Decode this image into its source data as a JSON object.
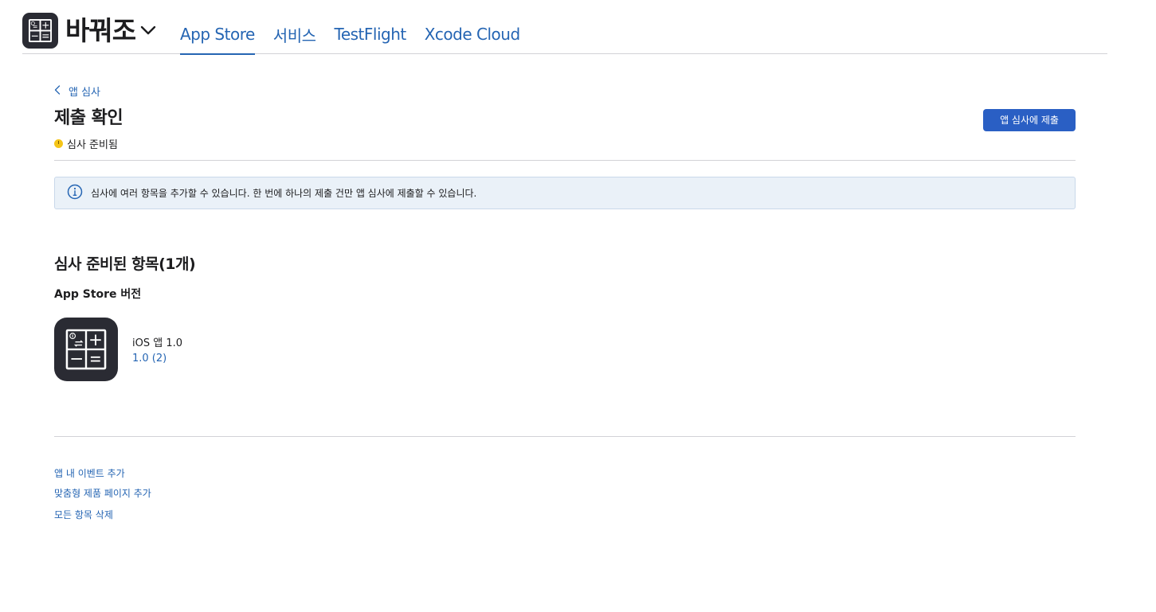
{
  "header": {
    "app_name": "바꿔조",
    "app_icon": "calculator-icon",
    "tabs": [
      {
        "label": "App Store",
        "active": true
      },
      {
        "label": "서비스",
        "active": false
      },
      {
        "label": "TestFlight",
        "active": false
      },
      {
        "label": "Xcode Cloud",
        "active": false
      }
    ]
  },
  "breadcrumb": {
    "label": "앱 심사"
  },
  "page": {
    "title": "제출 확인",
    "status": "심사 준비됨",
    "status_color": "#f5c518",
    "submit_button": "앱 심사에 제출"
  },
  "info_banner": {
    "text": "심사에 여러 항목을 추가할 수 있습니다. 한 번에 하나의 제출 건만 앱 심사에 제출할 수 있습니다."
  },
  "section": {
    "title": "심사 준비된 항목(1개)",
    "subsection": "App Store 버전",
    "item": {
      "name": "iOS 앱 1.0",
      "build": "1.0 (2)"
    }
  },
  "footer_links": [
    "앱 내 이벤트 추가",
    "맞춤형 제품 페이지 추가",
    "모든 항목 삭제"
  ],
  "colors": {
    "accent": "#2565b3",
    "button": "#2a5fc4",
    "icon_bg": "#2a2b33"
  }
}
